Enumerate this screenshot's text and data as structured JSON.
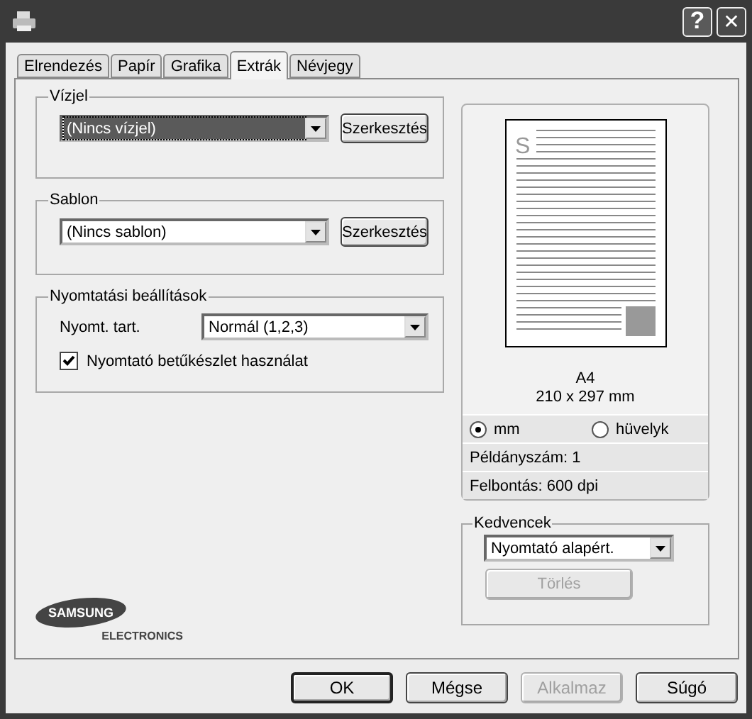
{
  "title_bar": {
    "buttons": [
      {
        "kind": "help",
        "label": "?"
      },
      {
        "kind": "close",
        "label": "✕"
      }
    ]
  },
  "tabs": [
    {
      "label": "Elrendezés",
      "selected": false
    },
    {
      "label": "Papír",
      "selected": false
    },
    {
      "label": "Grafika",
      "selected": false
    },
    {
      "label": "Extrák",
      "selected": true
    },
    {
      "label": "Névjegy",
      "selected": false
    }
  ],
  "watermark": {
    "legend": "Vízjel",
    "value": "(Nincs vízjel)",
    "focused": true,
    "button": "Szerkesztés"
  },
  "overlay": {
    "legend": "Sablon",
    "value": "(Nincs sablon)",
    "focused": false,
    "button": "Szerkesztés"
  },
  "print_settings": {
    "legend": "Nyomtatási beállítások",
    "order_label": "Nyomt. tart.",
    "order_value": "Normál (1,2,3)",
    "font_option": {
      "label": "Nyomtató betűkészlet használat",
      "checked": true
    }
  },
  "logo": {
    "brand": "SAMSUNG",
    "sub": "ELECTRONICS"
  },
  "preview": {
    "page_letter": "S",
    "paper": "A4",
    "size": "210 x 297 mm",
    "units": [
      {
        "label": "mm",
        "selected": true
      },
      {
        "label": "hüvelyk",
        "selected": false
      }
    ],
    "info": [
      "Példányszám: 1",
      "Felbontás: 600 dpi"
    ]
  },
  "favorites": {
    "legend": "Kedvencek",
    "value": "Nyomtató alapért.",
    "delete_button": {
      "label": "Törlés",
      "disabled": true
    }
  },
  "buttons": [
    {
      "label": "OK",
      "default": true,
      "disabled": false
    },
    {
      "label": "Mégse",
      "default": false,
      "disabled": false
    },
    {
      "label": "Alkalmaz",
      "default": false,
      "disabled": true
    },
    {
      "label": "Súgó",
      "default": false,
      "disabled": false
    }
  ]
}
